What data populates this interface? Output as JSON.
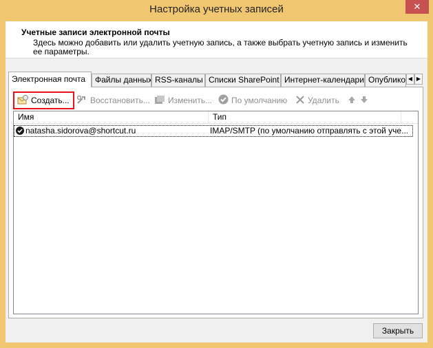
{
  "window": {
    "title": "Настройка учетных записей",
    "close_glyph": "✕"
  },
  "header": {
    "title": "Учетные записи электронной почты",
    "description": "Здесь можно добавить или удалить учетную запись, а также выбрать учетную запись и изменить ее параметры."
  },
  "tabs": [
    {
      "label": "Электронная почта",
      "active": true
    },
    {
      "label": "Файлы данных"
    },
    {
      "label": "RSS-каналы"
    },
    {
      "label": "Списки SharePoint"
    },
    {
      "label": "Интернет-календари"
    },
    {
      "label": "Опублико"
    }
  ],
  "toolbar": {
    "create_label": "Создать...",
    "restore_label": "Восстановить...",
    "change_label": "Изменить...",
    "default_label": "По умолчанию",
    "delete_label": "Удалить"
  },
  "accounts": {
    "columns": [
      "Имя",
      "Тип"
    ],
    "rows": [
      {
        "name": "natasha.sidorova@shortcut.ru",
        "type": "IMAP/SMTP (по умолчанию отправлять с этой уче...",
        "is_default": true
      }
    ]
  },
  "footer": {
    "close_label": "Закрыть"
  },
  "colors": {
    "titlebar": "#f0c770",
    "close_button": "#c75050",
    "highlight_border": "#e8101a"
  },
  "icons": [
    "create-account-icon",
    "restore-icon",
    "change-icon",
    "default-check-icon",
    "delete-x-icon",
    "arrow-up-icon",
    "arrow-down-icon",
    "default-account-check-icon"
  ]
}
